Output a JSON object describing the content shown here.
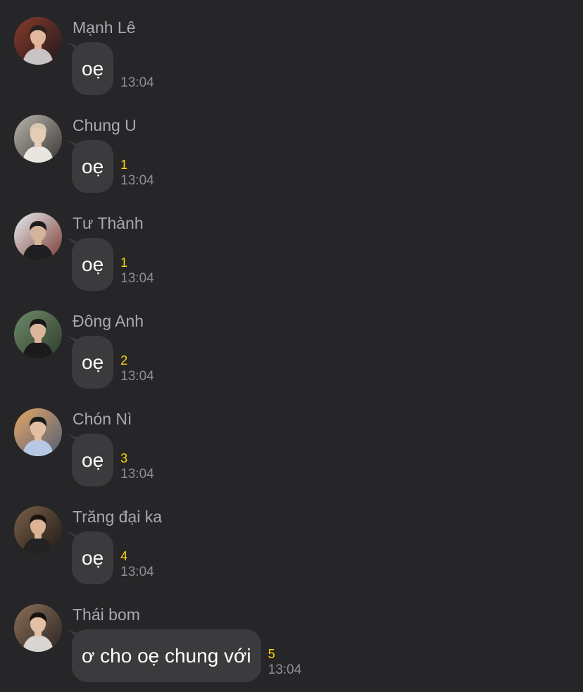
{
  "messages": [
    {
      "sender": "Mạnh Lê",
      "text": "oẹ",
      "unread": "",
      "time": "13:04",
      "avatar": {
        "bg1": "#8a3a2a",
        "bg2": "#1e1a1e",
        "skin": "#e2b79c",
        "hair": "#2a2220",
        "shirt": "#c9c3c4"
      }
    },
    {
      "sender": "Chung U",
      "text": "oẹ",
      "unread": "1",
      "time": "13:04",
      "avatar": {
        "bg1": "#b8b4ad",
        "bg2": "#3a3835",
        "skin": "#e6cdb8",
        "hair": "#d9c7b0",
        "shirt": "#e9e6e2"
      }
    },
    {
      "sender": "Tư Thành",
      "text": "oẹ",
      "unread": "1",
      "time": "13:04",
      "avatar": {
        "bg1": "#e8eef0",
        "bg2": "#7a3a34",
        "skin": "#d4b39a",
        "hair": "#1c1c1c",
        "shirt": "#1f1f22"
      }
    },
    {
      "sender": "Đông Anh",
      "text": "oẹ",
      "unread": "2",
      "time": "13:04",
      "avatar": {
        "bg1": "#6e8a6a",
        "bg2": "#2f3d2c",
        "skin": "#d9b59a",
        "hair": "#151515",
        "shirt": "#1b1b1d"
      }
    },
    {
      "sender": "Chón Nì",
      "text": "oẹ",
      "unread": "3",
      "time": "13:04",
      "avatar": {
        "bg1": "#e7a765",
        "bg2": "#4f5e78",
        "skin": "#e0bfa3",
        "hair": "#1a1a1a",
        "shirt": "#b7c8e2"
      }
    },
    {
      "sender": "Trăng đại ka",
      "text": "oẹ",
      "unread": "4",
      "time": "13:04",
      "avatar": {
        "bg1": "#7a6048",
        "bg2": "#1e1a16",
        "skin": "#dcb394",
        "hair": "#1a1410",
        "shirt": "#232323"
      }
    },
    {
      "sender": "Thái bom",
      "text": "ơ cho oẹ chung với",
      "unread": "5",
      "time": "13:04",
      "avatar": {
        "bg1": "#8a6e58",
        "bg2": "#2c2622",
        "skin": "#e2c0a6",
        "hair": "#151210",
        "shirt": "#d8d5d2"
      }
    }
  ]
}
